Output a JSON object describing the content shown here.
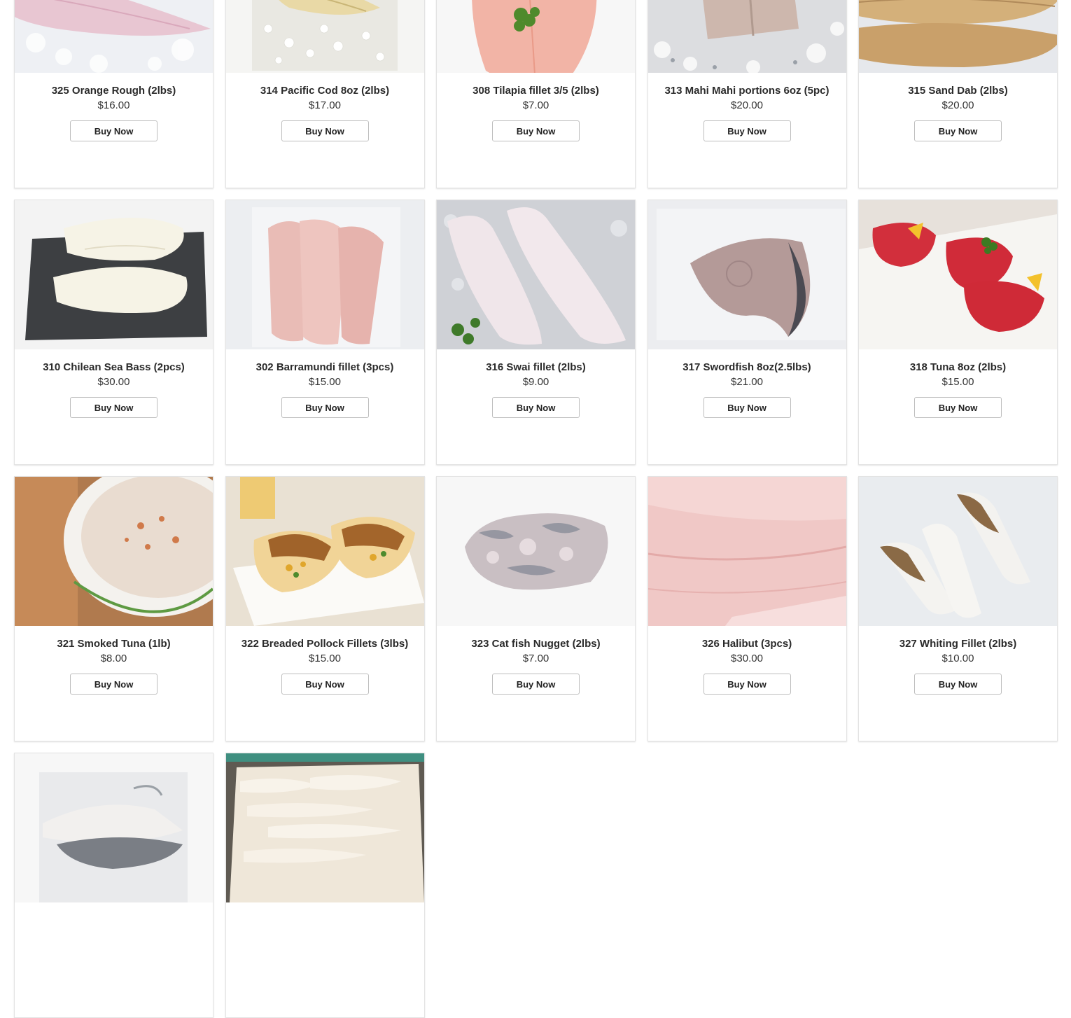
{
  "products": [
    {
      "name": "325 Orange Rough (2lbs)",
      "price": "$16.00",
      "button": "Buy Now",
      "image": "pink-fillet-on-ice"
    },
    {
      "name": "314 Pacific Cod 8oz (2lbs)",
      "price": "$17.00",
      "button": "Buy Now",
      "image": "cod-fillet-on-salt"
    },
    {
      "name": "308 Tilapia fillet 3/5 (2lbs)",
      "price": "$7.00",
      "button": "Buy Now",
      "image": "tilapia-fillet-with-parsley"
    },
    {
      "name": "313 Mahi Mahi portions 6oz (5pc)",
      "price": "$20.00",
      "button": "Buy Now",
      "image": "mahi-portions-on-ice"
    },
    {
      "name": "315 Sand Dab (2lbs)",
      "price": "$20.00",
      "button": "Buy Now",
      "image": "sand-dab-fillets"
    },
    {
      "name": "310 Chilean Sea Bass (2pcs)",
      "price": "$30.00",
      "button": "Buy Now",
      "image": "sea-bass-on-slate"
    },
    {
      "name": "302 Barramundi fillet (3pcs)",
      "price": "$15.00",
      "button": "Buy Now",
      "image": "barramundi-fillets"
    },
    {
      "name": "316 Swai fillet (2lbs)",
      "price": "$9.00",
      "button": "Buy Now",
      "image": "swai-fillets-on-ice"
    },
    {
      "name": "317 Swordfish 8oz(2.5lbs)",
      "price": "$21.00",
      "button": "Buy Now",
      "image": "swordfish-steak-on-ice"
    },
    {
      "name": "318 Tuna 8oz (2lbs)",
      "price": "$15.00",
      "button": "Buy Now",
      "image": "tuna-steaks-with-lemon"
    },
    {
      "name": "321 Smoked Tuna (1lb)",
      "price": "$8.00",
      "button": "Buy Now",
      "image": "smoked-tuna-dip-bowl"
    },
    {
      "name": "322 Breaded Pollock Fillets (3lbs)",
      "price": "$15.00",
      "button": "Buy Now",
      "image": "breaded-pollock-tacos"
    },
    {
      "name": "323 Cat fish Nugget (2lbs)",
      "price": "$7.00",
      "button": "Buy Now",
      "image": "catfish-nuggets"
    },
    {
      "name": "326 Halibut (3pcs)",
      "price": "$30.00",
      "button": "Buy Now",
      "image": "halibut-closeup"
    },
    {
      "name": "327 Whiting Fillet (2lbs)",
      "price": "$10.00",
      "button": "Buy Now",
      "image": "whiting-fillets-on-ice"
    },
    {
      "name": "",
      "price": "",
      "button": "",
      "image": "fish-fillets-on-white"
    },
    {
      "name": "",
      "price": "",
      "button": "",
      "image": "fillets-in-box"
    }
  ]
}
